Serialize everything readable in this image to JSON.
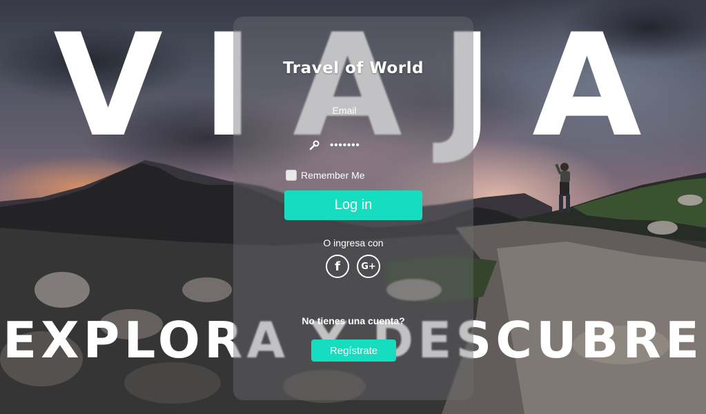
{
  "headline": {
    "top": "VIAJA",
    "bottom": "EXPLORA Y DESCUBRE"
  },
  "login": {
    "title": "Travel of World",
    "email_label": "Email",
    "email_value": "",
    "password_value": "•••••••",
    "remember_label": "Remember Me",
    "remember_checked": false,
    "submit_label": "Log in",
    "alt_login_text": "O ingresa con",
    "social": [
      {
        "icon": "facebook-icon",
        "glyph": "f"
      },
      {
        "icon": "google-plus-icon",
        "glyph": "G+"
      }
    ],
    "signup_prompt": "No tienes una cuenta?",
    "signup_label": "Regístrate"
  },
  "colors": {
    "accent": "#16dcc0",
    "panel": "rgba(110,110,115,0.42)",
    "text": "#ffffff"
  }
}
